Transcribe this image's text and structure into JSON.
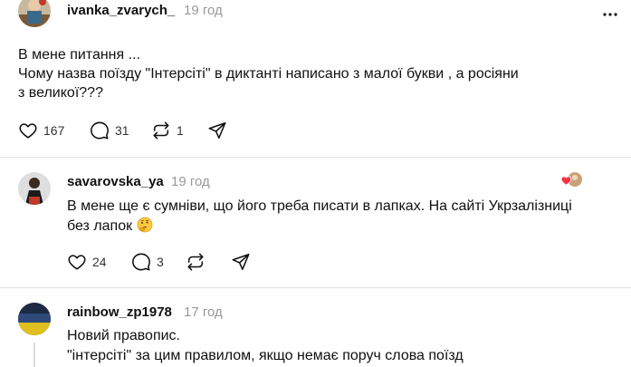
{
  "colors": {
    "text": "#101010",
    "muted": "#999999",
    "divider": "#e3e3e3",
    "heart": "#ff3040"
  },
  "posts": [
    {
      "username": "ivanka_zvarych_",
      "time": "19 год",
      "text_lines": [
        "В мене питання ...",
        "Чому назва поїзду \"Інтерсіті\" в диктанті написано з малої букви , а росіяни",
        "з великої???"
      ],
      "likes": "167",
      "comments": "31",
      "reposts": "1",
      "icons": [
        "heart-icon",
        "comment-icon",
        "repost-icon",
        "share-icon",
        "more-icon"
      ]
    },
    {
      "username": "savarovska_ya",
      "time": "19 год",
      "text_lines": [
        "В мене ще є сумніви, що його треба писати в лапках. На сайті Укрзалізниці",
        "без лапок"
      ],
      "emoji": "thinking-face-emoji",
      "likes": "24",
      "comments": "3",
      "icons": [
        "heart-icon",
        "comment-icon",
        "repost-icon",
        "share-icon",
        "liked-by-author-badge"
      ]
    },
    {
      "username": "rainbow_zp1978",
      "time": "17 год",
      "text_lines": [
        "Новий правопис.",
        "\"інтерсіті\" за цим правилом, якщо немає поруч слова поїзд"
      ]
    }
  ]
}
